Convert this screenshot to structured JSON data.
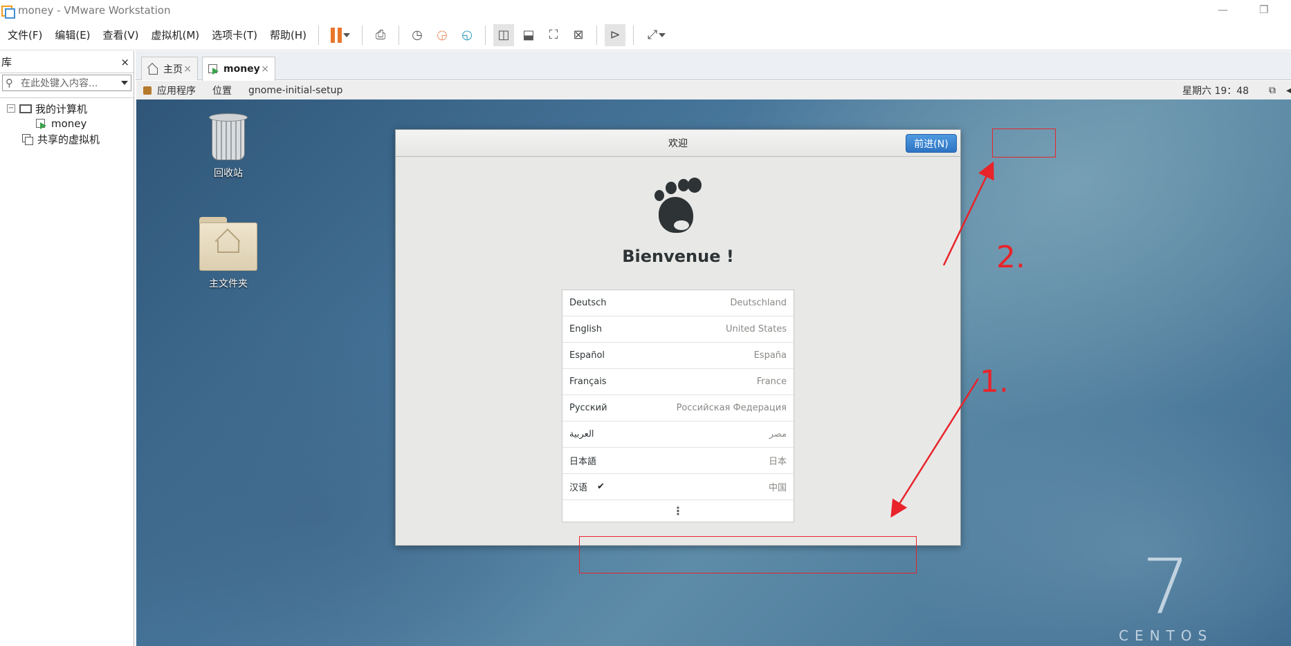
{
  "window": {
    "title": "money - VMware Workstation",
    "minimize_icon": "minimize-icon",
    "restore_icon": "restore-icon"
  },
  "menu": {
    "items": [
      "文件(F)",
      "编辑(E)",
      "查看(V)",
      "虚拟机(M)",
      "选项卡(T)",
      "帮助(H)"
    ]
  },
  "library": {
    "title": "库",
    "close_glyph": "×",
    "search_placeholder": "在此处键入内容...",
    "tree": {
      "my_computer": "我的计算机",
      "vm": "money",
      "shared": "共享的虚拟机"
    }
  },
  "tabs": [
    {
      "label": "主页"
    },
    {
      "label": "money"
    }
  ],
  "gnome_panel": {
    "apps": "应用程序",
    "places": "位置",
    "window": "gnome-initial-setup",
    "clock": "星期六 19：48"
  },
  "desktop": {
    "trash_label": "回收站",
    "home_label": "主文件夹",
    "brand_number": "7",
    "brand_word": "CENTOS"
  },
  "dialog": {
    "title": "欢迎",
    "next_button": "前进(N)",
    "heading": "Bienvenue !",
    "languages": [
      {
        "name": "Deutsch",
        "region": "Deutschland",
        "selected": false
      },
      {
        "name": "English",
        "region": "United States",
        "selected": false
      },
      {
        "name": "Español",
        "region": "España",
        "selected": false
      },
      {
        "name": "Français",
        "region": "France",
        "selected": false
      },
      {
        "name": "Русский",
        "region": "Российская Федерация",
        "selected": false
      },
      {
        "name": "العربية",
        "region": "مصر",
        "selected": false
      },
      {
        "name": "日本語",
        "region": "日本",
        "selected": false
      },
      {
        "name": "汉语",
        "region": "中国",
        "selected": true
      }
    ],
    "check_glyph": "✔",
    "more_glyph": "⋮"
  },
  "annotations": {
    "step1": "1.",
    "step2": "2.",
    "color": "#e8232a"
  },
  "colors": {
    "accent_button": "#2d74c4",
    "pause_orange": "#e8772a"
  }
}
